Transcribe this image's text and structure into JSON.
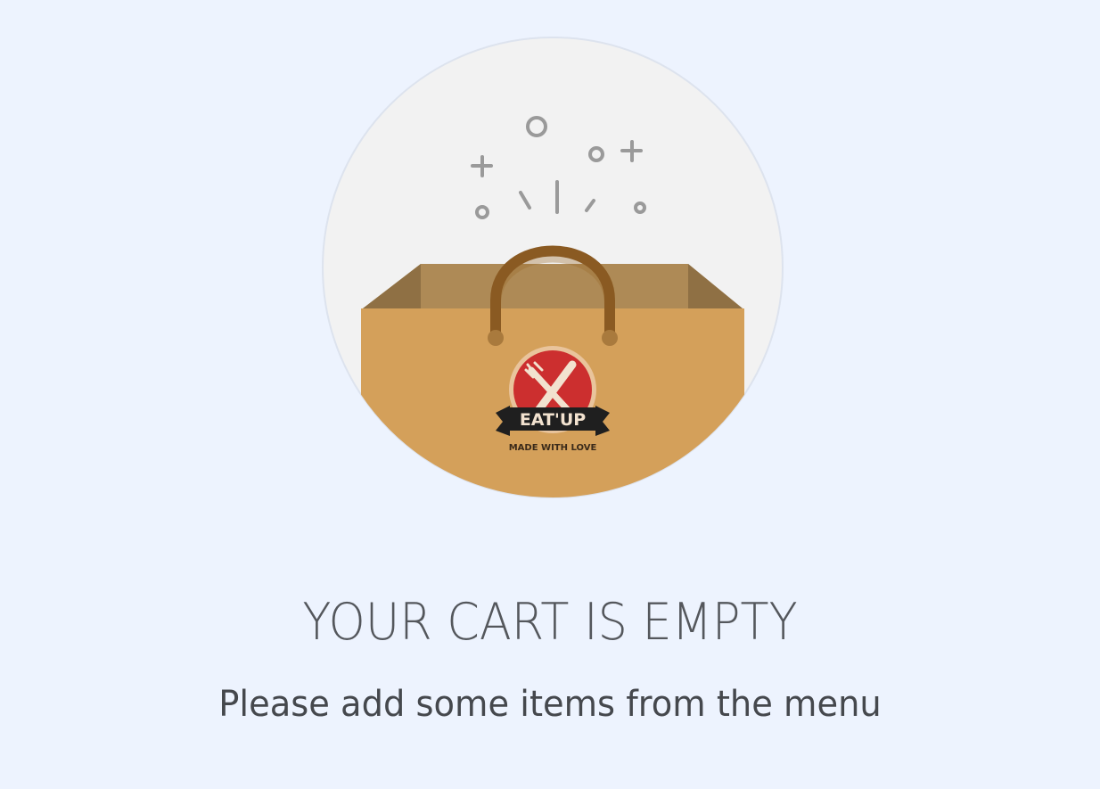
{
  "empty_state": {
    "title": "YOUR CART IS EMPTY",
    "subtitle": "Please add some items from the menu",
    "illustration": {
      "icon": "shopping-bag-icon",
      "brand_name": "EAT'UP",
      "brand_tagline": "MADE WITH LOVE"
    }
  },
  "colors": {
    "background": "#edf3fe",
    "circle": "#f2f2f2",
    "bag": "#d4a05a",
    "bag_inside": "#a98654",
    "handle": "#8a5a22",
    "logo_red": "#cc2f2f",
    "title_text": "#54575c",
    "subtitle_text": "#45484d"
  }
}
